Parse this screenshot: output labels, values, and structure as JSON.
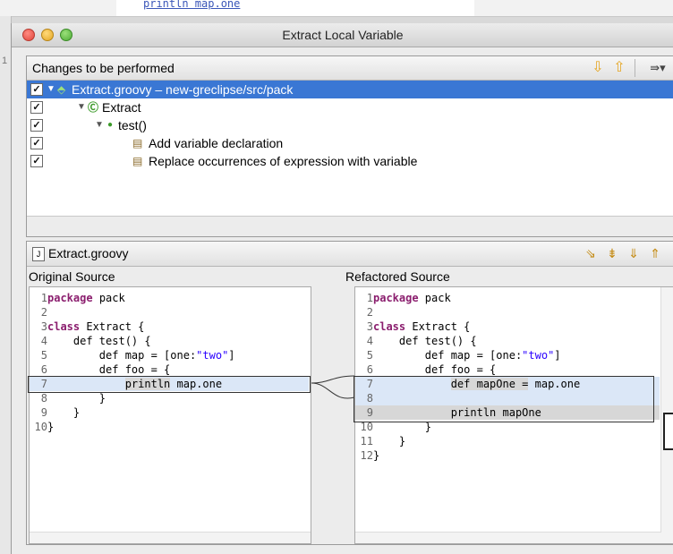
{
  "background": {
    "visible_code": "println map.one",
    "line_number": "1"
  },
  "window": {
    "title": "Extract Local Variable"
  },
  "changes": {
    "title": "Changes to be performed",
    "tree": [
      {
        "label": "Extract.groovy – new-greclipse/src/pack",
        "selected": true,
        "checked": true,
        "icon": "groovy-file-icon"
      },
      {
        "label": "Extract",
        "checked": true,
        "icon": "class-icon"
      },
      {
        "label": "test()",
        "checked": true,
        "icon": "method-icon"
      },
      {
        "label": "Add variable declaration",
        "checked": true,
        "icon": "change-icon"
      },
      {
        "label": "Replace occurrences of expression with variable",
        "checked": true,
        "icon": "change-icon"
      }
    ],
    "toolbar": {
      "next": "⇩",
      "prev": "⇧",
      "filter": "⇛▾"
    }
  },
  "compare": {
    "file": "Extract.groovy",
    "original_title": "Original Source",
    "refactored_title": "Refactored Source",
    "original": [
      {
        "n": "1",
        "code": "package pack"
      },
      {
        "n": "2",
        "code": ""
      },
      {
        "n": "3",
        "code": "class Extract {"
      },
      {
        "n": "4",
        "code": "    def test() {"
      },
      {
        "n": "5",
        "code": "        def map = [one:\"two\"]"
      },
      {
        "n": "6",
        "code": "        def foo = {"
      },
      {
        "n": "7",
        "code": "            println map.one"
      },
      {
        "n": "8",
        "code": "        }"
      },
      {
        "n": "9",
        "code": "    }"
      },
      {
        "n": "10",
        "code": "}"
      }
    ],
    "refactored": [
      {
        "n": "1",
        "code": "package pack"
      },
      {
        "n": "2",
        "code": ""
      },
      {
        "n": "3",
        "code": "class Extract {"
      },
      {
        "n": "4",
        "code": "    def test() {"
      },
      {
        "n": "5",
        "code": "        def map = [one:\"two\"]"
      },
      {
        "n": "6",
        "code": "        def foo = {"
      },
      {
        "n": "7",
        "code": "            def mapOne = map.one"
      },
      {
        "n": "8",
        "code": ""
      },
      {
        "n": "9",
        "code": "            println mapOne"
      },
      {
        "n": "10",
        "code": "        }"
      },
      {
        "n": "11",
        "code": "    }"
      },
      {
        "n": "12",
        "code": "}"
      }
    ]
  },
  "colors": {
    "selection": "#3a77d4",
    "keyword": "#8b1e6e",
    "string": "#2a00ff"
  }
}
